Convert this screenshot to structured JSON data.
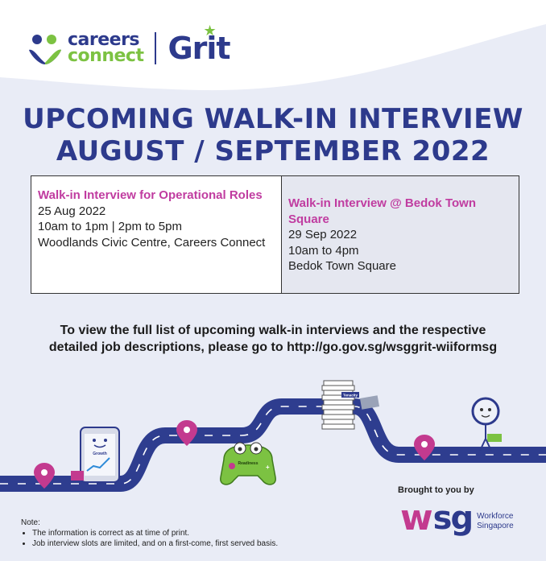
{
  "header": {
    "careers_line1": "careers",
    "careers_line2": "connect",
    "grit": "Grit"
  },
  "title": {
    "line1": "UPCOMING WALK-IN INTERVIEW",
    "line2": "AUGUST / SEPTEMBER 2022"
  },
  "events": [
    {
      "title": "Walk-in Interview for Operational Roles",
      "date": "25 Aug 2022",
      "time": "10am to 1pm | 2pm to 5pm",
      "venue": "Woodlands Civic Centre, Careers Connect"
    },
    {
      "title": "Walk-in Interview @ Bedok Town Square",
      "date": "29 Sep 2022",
      "time": "10am to 4pm",
      "venue": "Bedok Town Square"
    }
  ],
  "info": {
    "line1": "To view the full list of upcoming walk-in interviews and the respective",
    "line2": "detailed job descriptions, please go to http://go.gov.sg/wsggrit-wiiformsg"
  },
  "illustration": {
    "tablet_label": "Growth",
    "controller_label": "Readiness",
    "books_label": "Tenacity"
  },
  "footer": {
    "brought_by": "Brought to you by",
    "wsg_w": "w",
    "wsg_sg": "sg",
    "wsg_line1": "Workforce",
    "wsg_line2": "Singapore",
    "note_title": "Note:",
    "notes": [
      "The information is correct as at time of print.",
      "Job interview slots are limited, and on a first-come, first served basis."
    ]
  },
  "colors": {
    "navy": "#2d3a8c",
    "green": "#7cc242",
    "magenta": "#c33a8f",
    "road": "#2e3d8f"
  }
}
